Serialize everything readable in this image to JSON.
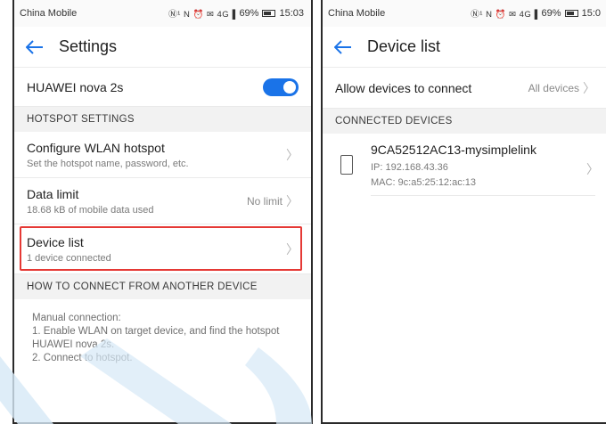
{
  "status_left": {
    "carrier": "China Mobile",
    "icons": "Ⓝ¹ N ⏰ ✉ 4G▐",
    "battery_pct": "69%",
    "time": "15:03"
  },
  "status_right": {
    "carrier": "China Mobile",
    "icons": "Ⓝ¹ N ⏰ ✉ 4G▐",
    "battery_pct": "69%",
    "time": "15:0"
  },
  "settings": {
    "title": "Settings",
    "device_name": "HUAWEI nova 2s",
    "hotspot_enabled": true,
    "hotspot_section": "HOTSPOT SETTINGS",
    "configure": {
      "label": "Configure WLAN hotspot",
      "sub": "Set the hotspot name, password, etc."
    },
    "data_limit": {
      "label": "Data limit",
      "sub": "18.68 kB of mobile data used",
      "value": "No limit"
    },
    "device_list": {
      "label": "Device list",
      "sub": "1 device connected"
    },
    "connect_section": "HOW TO CONNECT FROM ANOTHER DEVICE",
    "instructions": {
      "line1": "Manual connection:",
      "line2": "1. Enable WLAN on target device, and find the hotspot",
      "line3": "HUAWEI nova 2s.",
      "line4": "2. Connect to hotspot."
    }
  },
  "device_list": {
    "title": "Device list",
    "allow": {
      "label": "Allow devices to connect",
      "value": "All devices"
    },
    "section": "CONNECTED DEVICES",
    "device": {
      "name": "9CA52512AC13-mysimplelink",
      "ip": "IP: 192.168.43.36",
      "mac": "MAC: 9c:a5:25:12:ac:13"
    }
  },
  "colors": {
    "accent": "#1a73e8",
    "highlight": "#e53935",
    "watermark": "#d6e8f6"
  }
}
